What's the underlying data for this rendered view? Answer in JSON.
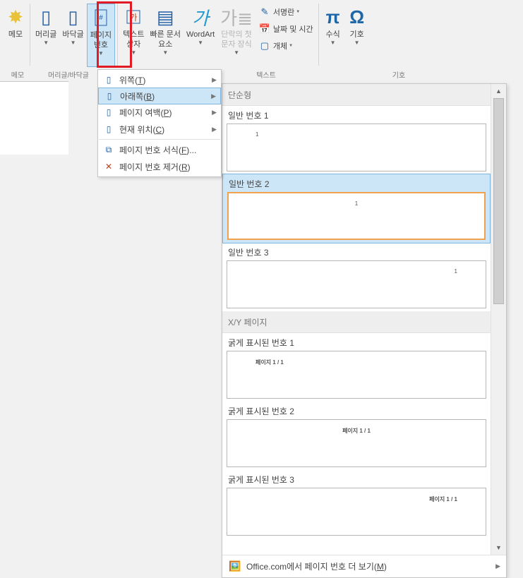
{
  "ribbon": {
    "memo": "메모",
    "header": "머리글",
    "footer": "바닥글",
    "page": "페이지\n번호",
    "textbox": "텍스트\n상자",
    "quick": "빠른 문서\n요소",
    "wordart": "WordArt",
    "drop": "단락의 첫\n문자 장식",
    "sig": "서명란",
    "dt": "날짜 및 시간",
    "obj": "개체",
    "eq": "수식",
    "sym": "기호",
    "grpMemo": "메모",
    "grpHF": "머리글/바닥글",
    "grpText": "텍스트",
    "grpSym": "기호"
  },
  "menu": {
    "top": "위쪽(T)",
    "bottom": "아래쪽(B)",
    "margin": "페이지 여백(P)",
    "current": "현재 위치(C)",
    "format": "페이지 번호 서식(F)...",
    "remove": "페이지 번호 제거(R)"
  },
  "gallery": {
    "hdr1": "단순형",
    "p1": "일반 번호 1",
    "p2": "일반 번호 2",
    "p3": "일반 번호 3",
    "hdr2": "X/Y 페이지",
    "b1": "굵게 표시된 번호 1",
    "b2": "굵게 표시된 번호 2",
    "b3": "굵게 표시된 번호 3",
    "num1": "1",
    "xy": "페이지 1 / 1",
    "footer": "Office.com에서 페이지 번호 더 보기(M)"
  }
}
